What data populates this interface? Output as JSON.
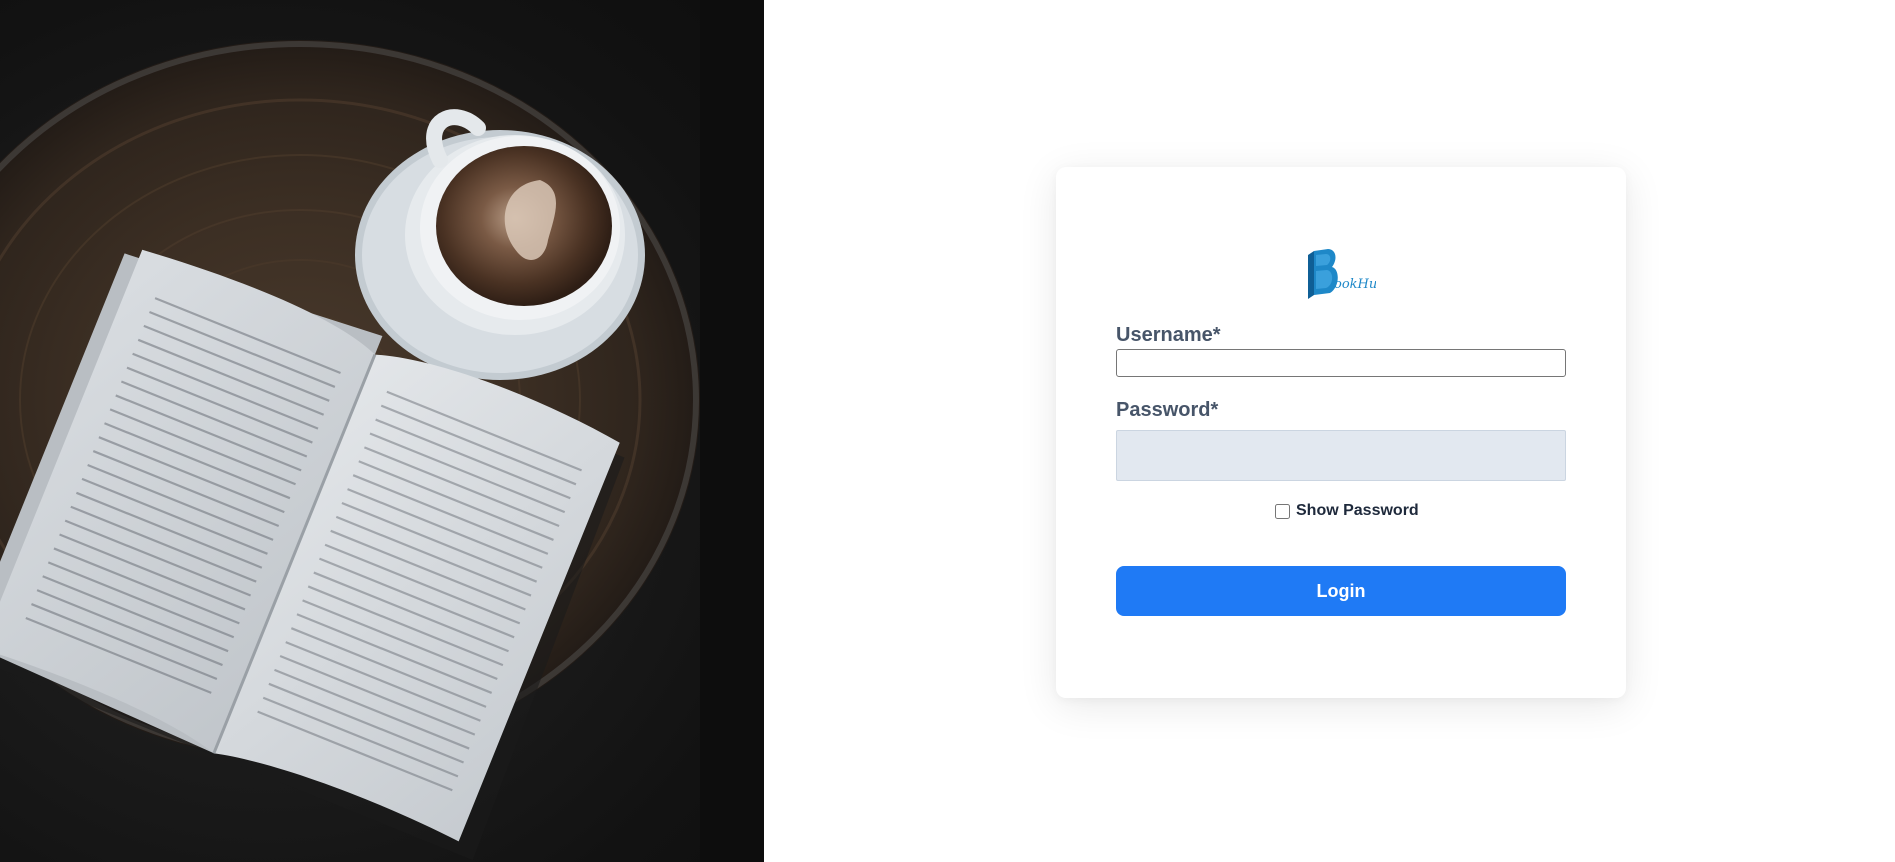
{
  "hero": {
    "description_icon": "book-and-coffee-photo"
  },
  "brand": {
    "logo_letter": "B",
    "logo_text": "ookHub",
    "logo_color": "#1e88c8"
  },
  "form": {
    "username_label": "Username*",
    "username_value": "",
    "password_label": "Password*",
    "password_value": "",
    "show_password_label": "Show Password",
    "show_password_checked": false,
    "login_label": "Login"
  },
  "colors": {
    "accent": "#1f7af5",
    "label": "#475569",
    "password_bg": "#e2e8f0"
  }
}
